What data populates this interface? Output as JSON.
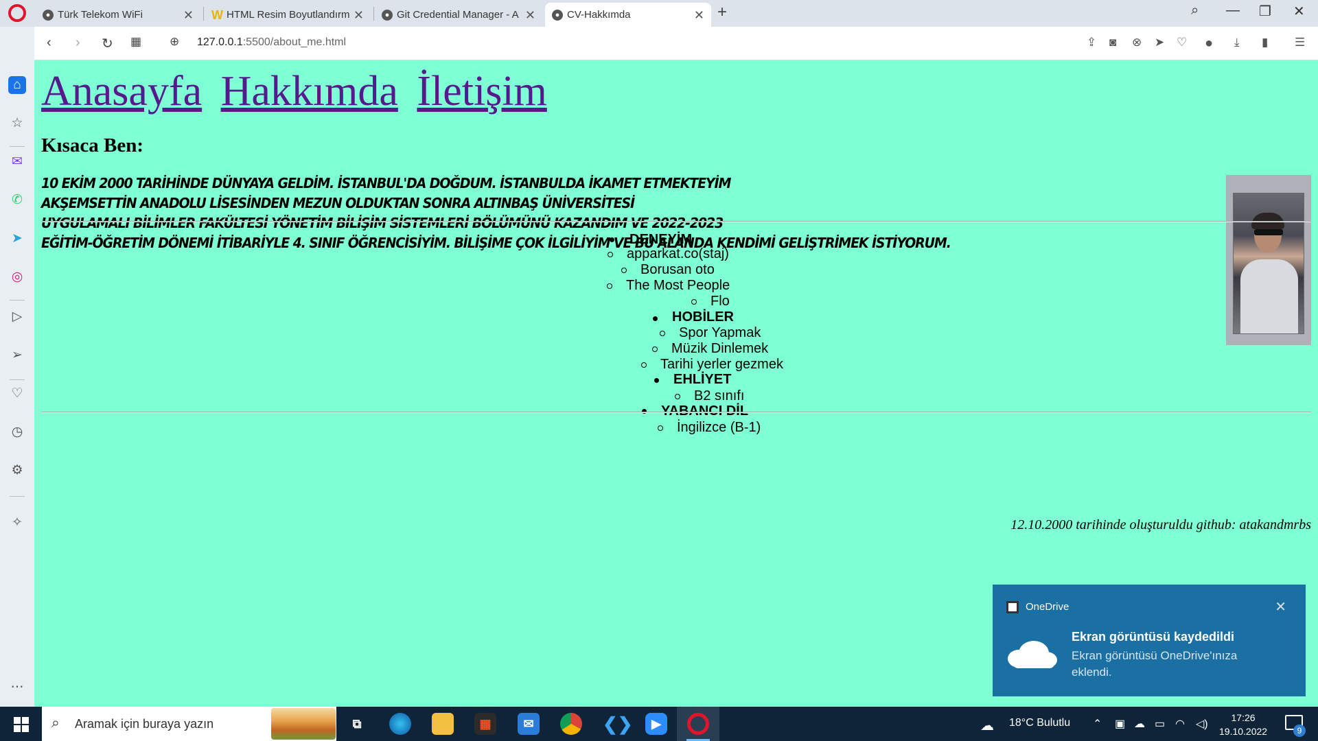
{
  "browser": {
    "tabs": [
      {
        "title": "Türk Telekom WiFi",
        "active": false
      },
      {
        "title": "HTML Resim Boyutlandırma",
        "active": false
      },
      {
        "title": "Git Credential Manager - A",
        "active": false
      },
      {
        "title": "CV-Hakkımda",
        "active": true
      }
    ],
    "url_host": "127.0.0.1",
    "url_rest": ":5500/about_me.html"
  },
  "page": {
    "nav": [
      "Anasayfa",
      "Hakkımda",
      "İletişim"
    ],
    "heading": "Kısaca Ben:",
    "bio_lines": [
      "10 EKİM 2000 TARİHİNDE DÜNYAYA GELDİM. İSTANBUL'DA DOĞDUM. İSTANBULDA İKAMET ETMEKTEYİM",
      "AKŞEMSETTİN ANADOLU LİSESİNDEN MEZUN OLDUKTAN SONRA ALTINBAŞ ÜNİVERSİTESİ",
      "UYGULAMALI BİLİMLER FAKÜLTESİ YÖNETİM BİLİŞİM SİSTEMLERİ BÖLÜMÜNÜ KAZANDIM VE 2022-2023",
      "EĞİTİM-ÖĞRETİM DÖNEMİ İTİBARİYLE 4. SINIF ÖĞRENCİSİYİM. BİLİŞİME ÇOK İLGİLİYİM VE BU ALANDA KENDİMİ GELİŞTRİMEK İSTİYORUM."
    ],
    "list": {
      "experience_title": "DENEYİM",
      "experience": [
        "apparkat.co(staj)",
        "Borusan oto",
        "The Most People",
        "Flo"
      ],
      "hobbies_title": "HOBİLER",
      "hobbies": [
        "Spor Yapmak",
        "Müzik Dinlemek",
        "Tarihi yerler gezmek"
      ],
      "license_title": "EHLİYET",
      "license": [
        "B2 sınıfı"
      ],
      "language_title": "YABANCI DİL",
      "language": [
        "İngilizce (B-1)"
      ]
    },
    "footer": "12.10.2000 tarihinde oluşturuldu github: atakandmrbs",
    "background_color": "#7fffd4",
    "link_color": "#551a8b"
  },
  "toast": {
    "app": "OneDrive",
    "title": "Ekran görüntüsü kaydedildi",
    "body": "Ekran görüntüsü OneDrive'ınıza eklendi."
  },
  "taskbar": {
    "search_placeholder": "Aramak için buraya yazın",
    "weather": "18°C  Bulutlu",
    "time": "17:26",
    "date": "19.10.2022",
    "notification_count": "9"
  }
}
